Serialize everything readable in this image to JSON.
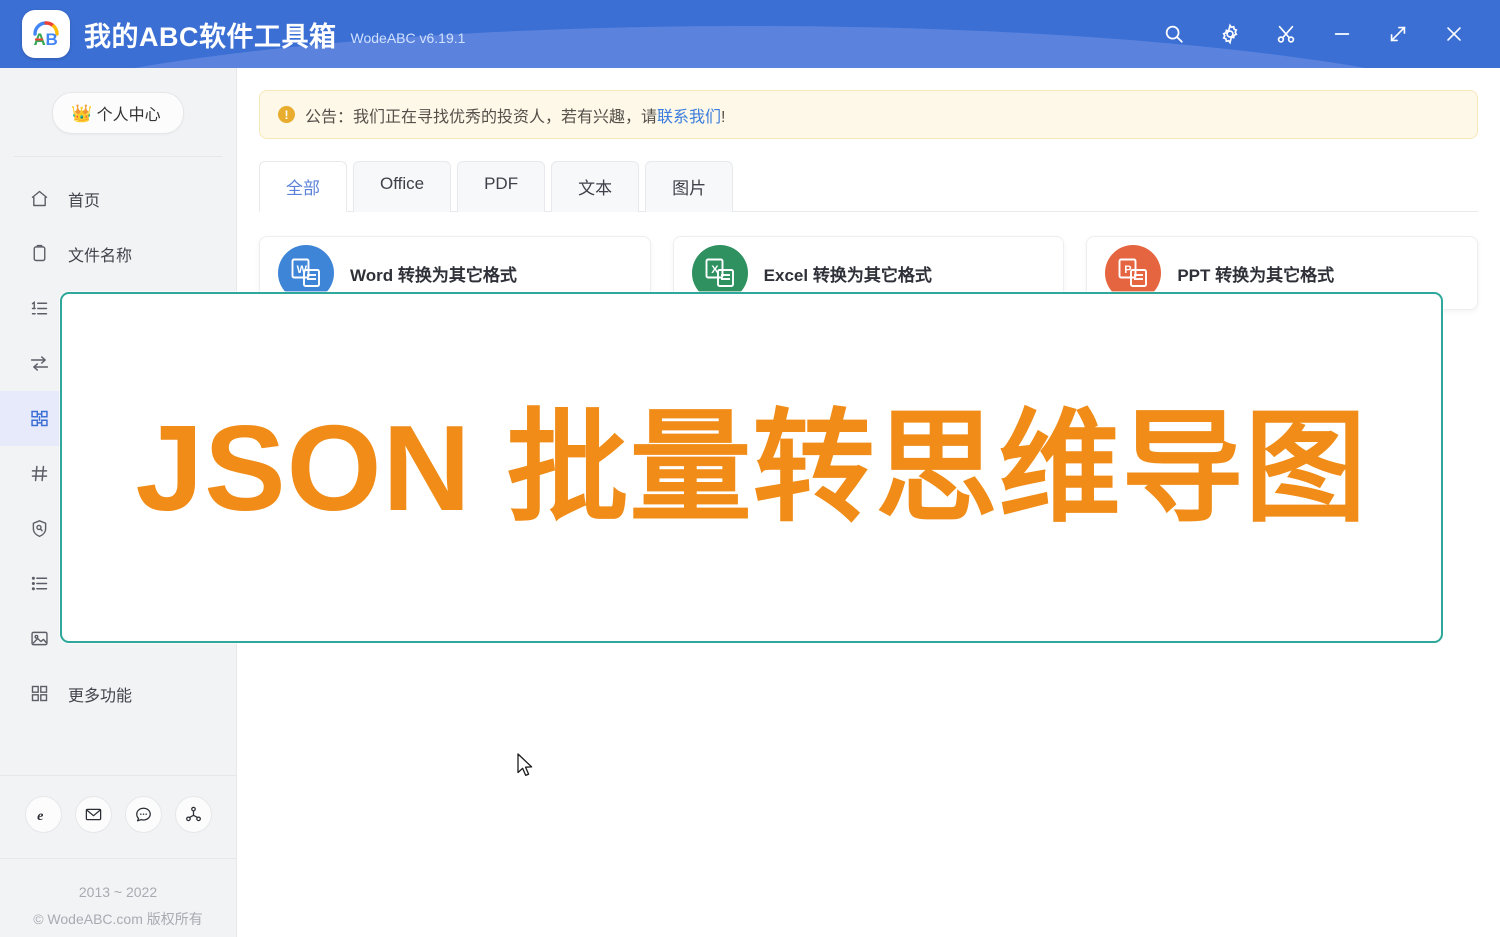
{
  "window": {
    "app_title": "我的ABC软件工具箱",
    "app_version": "WodeABC v6.19.1",
    "logo_text": "AB",
    "controls": [
      {
        "name": "search-icon",
        "label": "搜索"
      },
      {
        "name": "gear-icon",
        "label": "设置"
      },
      {
        "name": "scissors-icon",
        "label": "截图"
      },
      {
        "name": "minimize-icon",
        "label": "最小化"
      },
      {
        "name": "maximize-icon",
        "label": "最大化"
      },
      {
        "name": "close-icon",
        "label": "关闭"
      }
    ]
  },
  "sidebar": {
    "profile_button": {
      "icon": "crown-icon",
      "glyph": "👑",
      "label": "个人中心"
    },
    "items": [
      {
        "icon": "home-icon",
        "label": "首页",
        "active": false
      },
      {
        "icon": "file-name-icon",
        "label": "文件名称",
        "active": false
      },
      {
        "icon": "list-ordered-icon",
        "label": "",
        "active": false
      },
      {
        "icon": "transfer-icon",
        "label": "",
        "active": false
      },
      {
        "icon": "grid-convert-icon",
        "label": "",
        "active": true
      },
      {
        "icon": "hash-icon",
        "label": "",
        "active": false
      },
      {
        "icon": "shield-search-icon",
        "label": "",
        "active": false
      },
      {
        "icon": "list-icon",
        "label": "",
        "active": false
      },
      {
        "icon": "image-icon",
        "label": "",
        "active": false
      },
      {
        "icon": "apps-grid-icon",
        "label": "更多功能",
        "active": false
      }
    ],
    "social": [
      {
        "icon": "browser-e-icon",
        "label": "官网"
      },
      {
        "icon": "mail-icon",
        "label": "邮箱"
      },
      {
        "icon": "chat-icon",
        "label": "反馈"
      },
      {
        "icon": "share-icon",
        "label": "分享"
      }
    ],
    "copyright_years": "2013 ~ 2022",
    "copyright_text": "© WodeABC.com 版权所有"
  },
  "notice": {
    "icon": "alert-icon",
    "icon_glyph": "!",
    "prefix": "公告：我们正在寻找优秀的投资人，若有兴趣，请",
    "link": "联系我们",
    "suffix": "!"
  },
  "tabs": [
    {
      "label": "全部",
      "active": true
    },
    {
      "label": "Office",
      "active": false
    },
    {
      "label": "PDF",
      "active": false
    },
    {
      "label": "文本",
      "active": false
    },
    {
      "label": "图片",
      "active": false
    }
  ],
  "cards": [
    {
      "icon": "word-file-icon",
      "badge": "W",
      "title": "Word 转换为其它格式",
      "color": "#3e85d8"
    },
    {
      "icon": "excel-file-icon",
      "badge": "X",
      "title": "Excel 转换为其它格式",
      "color": "#2f9060"
    },
    {
      "icon": "ppt-file-icon",
      "badge": "P",
      "title": "PPT 转换为其它格式",
      "color": "#e4653f"
    }
  ],
  "overlay": {
    "text": "JSON 批量转思维导图",
    "text_color": "#f08c17",
    "border_color": "#2fa79b"
  },
  "colors": {
    "titlebar": "#3b6fd4",
    "sidebar_bg": "#f2f3f5",
    "accent_blue": "#3b6fd4",
    "active_item_bg": "#e6eafb",
    "notice_bg": "#fdf8e8",
    "link_blue": "#3b7ddd"
  }
}
